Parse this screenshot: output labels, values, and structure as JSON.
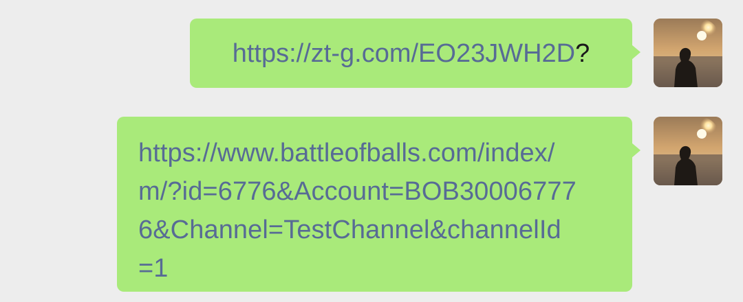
{
  "chat": {
    "messages": [
      {
        "link_text": "https://zt-g.com/EO23JWH2D",
        "suffix": "?"
      },
      {
        "lines": [
          "https://www.battleofballs.com/index/",
          "m/?id=6776&Account=BOB30006777",
          "6&Channel=TestChannel&channelId",
          "=1"
        ]
      }
    ]
  },
  "colors": {
    "background": "#ededed",
    "bubble": "#a9ea7a",
    "link": "#576b95",
    "text": "#1a1a1a"
  },
  "icons": {
    "avatar": "sunset-silhouette-avatar"
  }
}
